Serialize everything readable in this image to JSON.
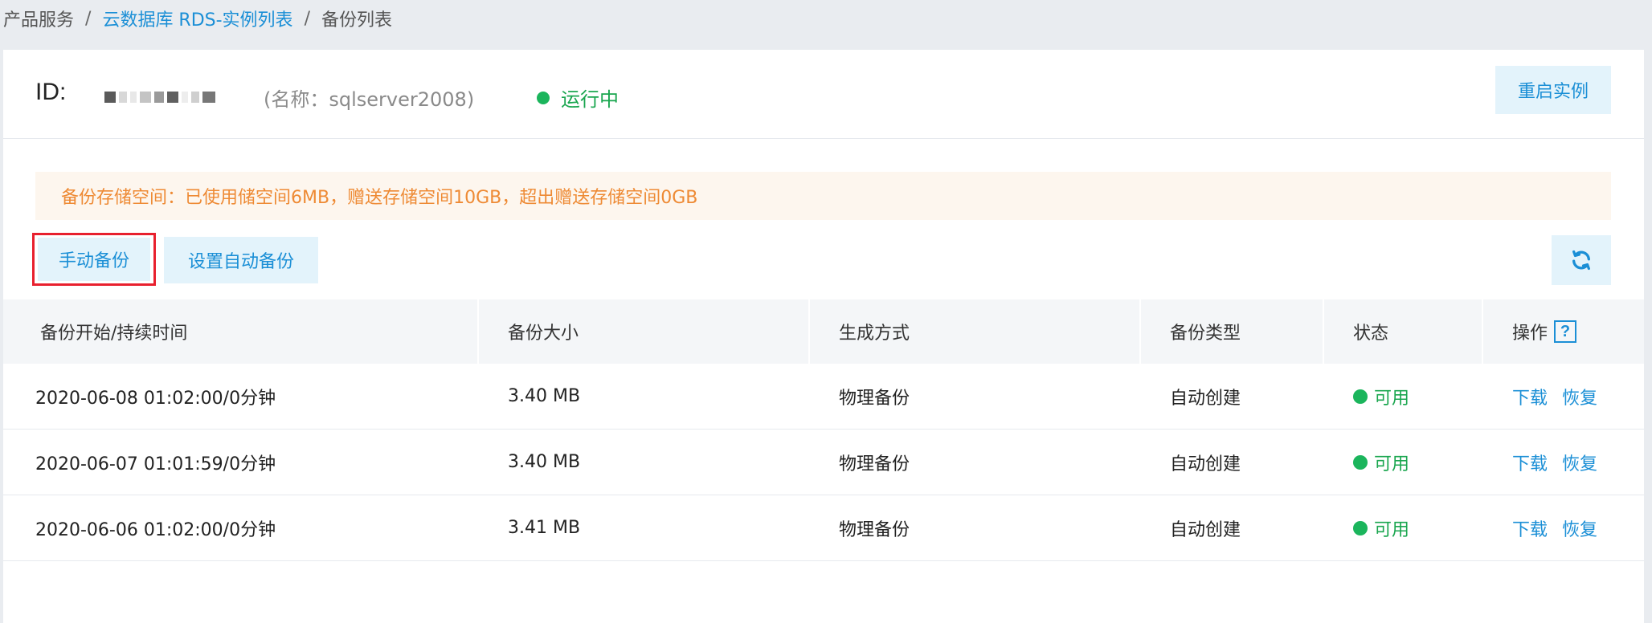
{
  "breadcrumb": {
    "items": [
      "产品服务",
      "云数据库 RDS-实例列表",
      "备份列表"
    ],
    "separator": "/"
  },
  "instance": {
    "id_label": "ID:",
    "name_text": "(名称：sqlserver2008)",
    "status": "运行中",
    "restart_button": "重启实例"
  },
  "notice": {
    "text": "备份存储空间：已使用储空间6MB，赠送存储空间10GB，超出赠送存储空间0GB"
  },
  "toolbar": {
    "manual_backup": "手动备份",
    "auto_backup": "设置自动备份",
    "refresh_icon": "refresh-icon"
  },
  "table": {
    "columns": [
      "备份开始/持续时间",
      "备份大小",
      "生成方式",
      "备份类型",
      "状态",
      "操作"
    ],
    "help_icon": "?",
    "rows": [
      {
        "time": "2020-06-08 01:02:00/0分钟",
        "size": "3.40 MB",
        "method": "物理备份",
        "type": "自动创建",
        "status": "可用",
        "download": "下载",
        "restore": "恢复"
      },
      {
        "time": "2020-06-07 01:01:59/0分钟",
        "size": "3.40 MB",
        "method": "物理备份",
        "type": "自动创建",
        "status": "可用",
        "download": "下载",
        "restore": "恢复"
      },
      {
        "time": "2020-06-06 01:02:00/0分钟",
        "size": "3.41 MB",
        "method": "物理备份",
        "type": "自动创建",
        "status": "可用",
        "download": "下载",
        "restore": "恢复"
      }
    ]
  },
  "colors": {
    "link": "#1b8fd6",
    "success": "#1aa64f",
    "warning": "#ee8a34",
    "highlight_border": "#e8202e"
  }
}
